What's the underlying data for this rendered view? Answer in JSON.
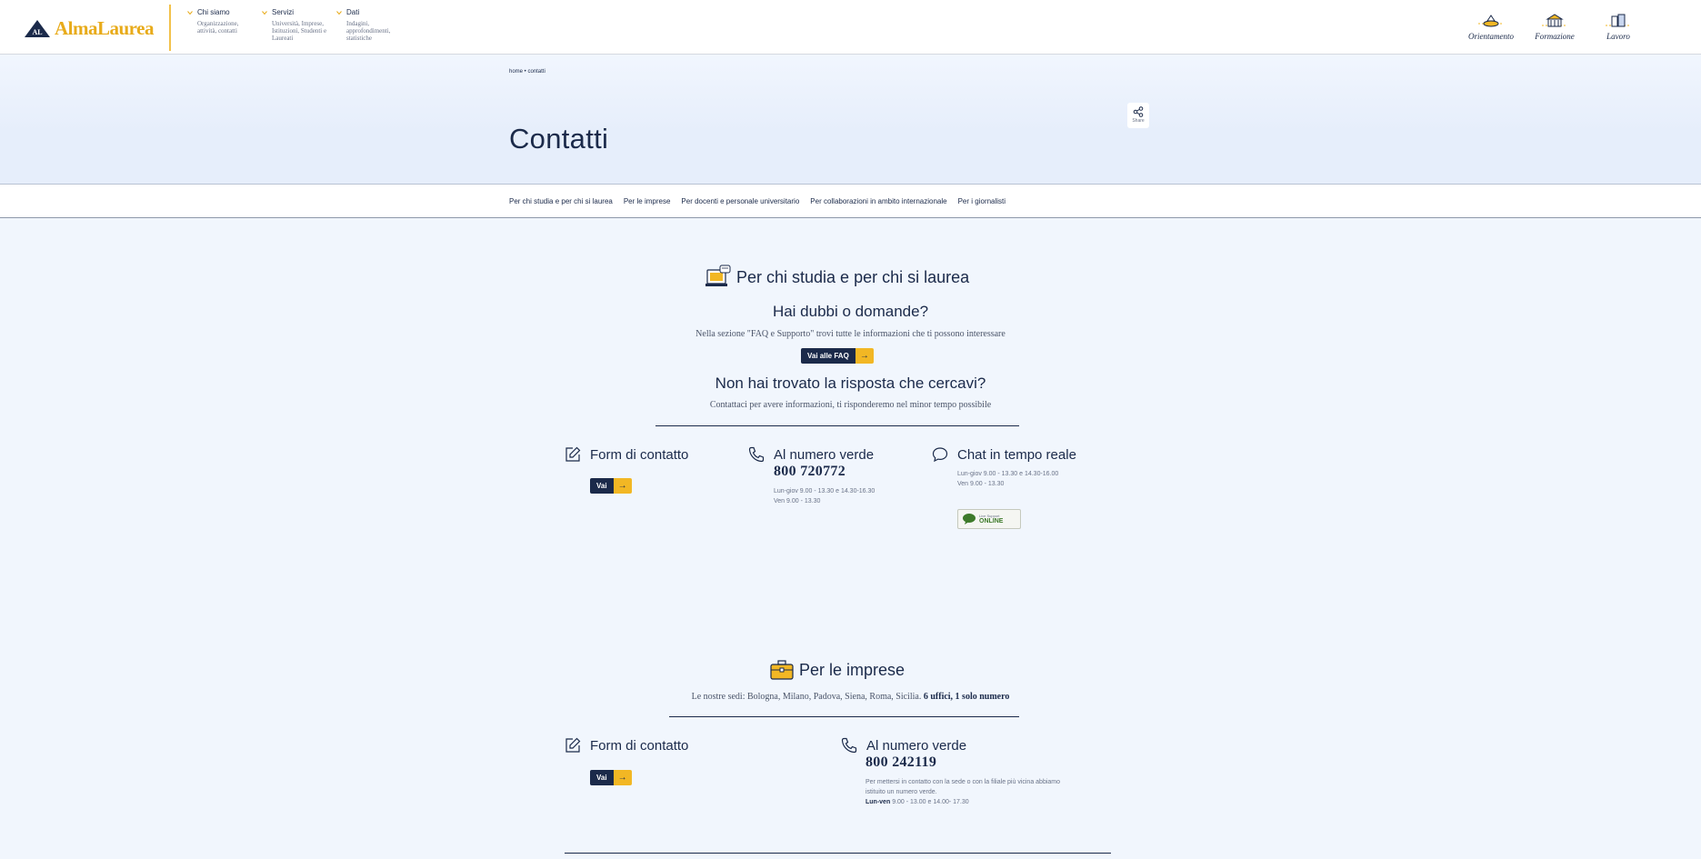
{
  "header": {
    "logo_text": "AlmaLaurea",
    "logo_mark": "AL",
    "nav": [
      {
        "title": "Chi siamo",
        "desc": "Organizzazione, attività, contatti"
      },
      {
        "title": "Servizi",
        "desc": "Università, Imprese, Istituzioni, Studenti e Laureati"
      },
      {
        "title": "Dati",
        "desc": "Indagini, approfondimenti, statistiche"
      }
    ],
    "tools": [
      {
        "label": "Orientamento",
        "icon": "orientamento-icon"
      },
      {
        "label": "Formazione",
        "icon": "formazione-icon"
      },
      {
        "label": "Lavoro",
        "icon": "lavoro-icon"
      }
    ]
  },
  "hero": {
    "breadcrumb": "home • contatti",
    "title": "Contatti",
    "share_label": "Share"
  },
  "tabs": [
    "Per chi studia e per chi si laurea",
    "Per le imprese",
    "Per docenti e personale universitario",
    "Per collaborazioni in ambito internazionale",
    "Per i giornalisti"
  ],
  "students": {
    "title": "Per chi studia e per chi si laurea",
    "faq_title": "Hai dubbi o domande?",
    "faq_text": "Nella sezione \"FAQ e Supporto\" trovi tutte le informazioni che ti possono interessare",
    "faq_button": "Vai alle FAQ",
    "not_found_title": "Non hai trovato la risposta che cercavi?",
    "not_found_text": "Contattaci per avere informazioni, ti risponderemo nel minor tempo possibile",
    "form_title": "Form di contatto",
    "form_button": "Vai",
    "phone_title": "Al numero verde",
    "phone_number": "800 720772",
    "phone_hours_1": "Lun-giov 9.00 - 13.30 e 14.30-16.30",
    "phone_hours_2": "Ven 9.00 - 13.30",
    "chat_title": "Chat in tempo reale",
    "chat_hours_1": "Lun-giov 9.00 - 13.30 e 14.30-16.00",
    "chat_hours_2": "Ven 9.00 - 13.30",
    "live_top": "Live Support",
    "live_bottom": "ONLINE"
  },
  "companies": {
    "title": "Per le imprese",
    "text_prefix": "Le nostre sedi: Bologna, Milano, Padova, Siena, Roma, Sicilia.",
    "text_bold": "6 uffici, 1 solo numero",
    "form_title": "Form di contatto",
    "form_button": "Vai",
    "phone_title": "Al numero verde",
    "phone_number": "800 242119",
    "phone_desc_1": "Per mettersi in contatto con la sede o con la filiale più vicina abbiamo",
    "phone_desc_2": "istituito un numero verde.",
    "phone_hours_label": "Lun-ven",
    "phone_hours": "9.00 - 13.00 e 14.00- 17.30"
  },
  "colors": {
    "navy": "#1b2a4a",
    "gold": "#f2b724",
    "bg": "#f1f6fd"
  }
}
